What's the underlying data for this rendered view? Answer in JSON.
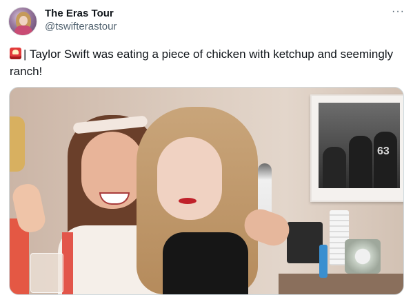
{
  "post": {
    "author": {
      "display_name": "The Eras Tour",
      "handle": "@tswifterastour",
      "avatar": "profile-photo"
    },
    "more_icon": "ellipsis-icon",
    "more_label": "···",
    "text": "| Taylor Swift was eating a piece of chicken with ketchup and seemingly ranch!",
    "emoji": "rotating-light-icon",
    "media": {
      "type": "photo",
      "framed_photo_jersey_numbers": [
        "63"
      ]
    }
  },
  "colors": {
    "text": "#0f1419",
    "secondary_text": "#536471",
    "border": "#cfd9de"
  }
}
